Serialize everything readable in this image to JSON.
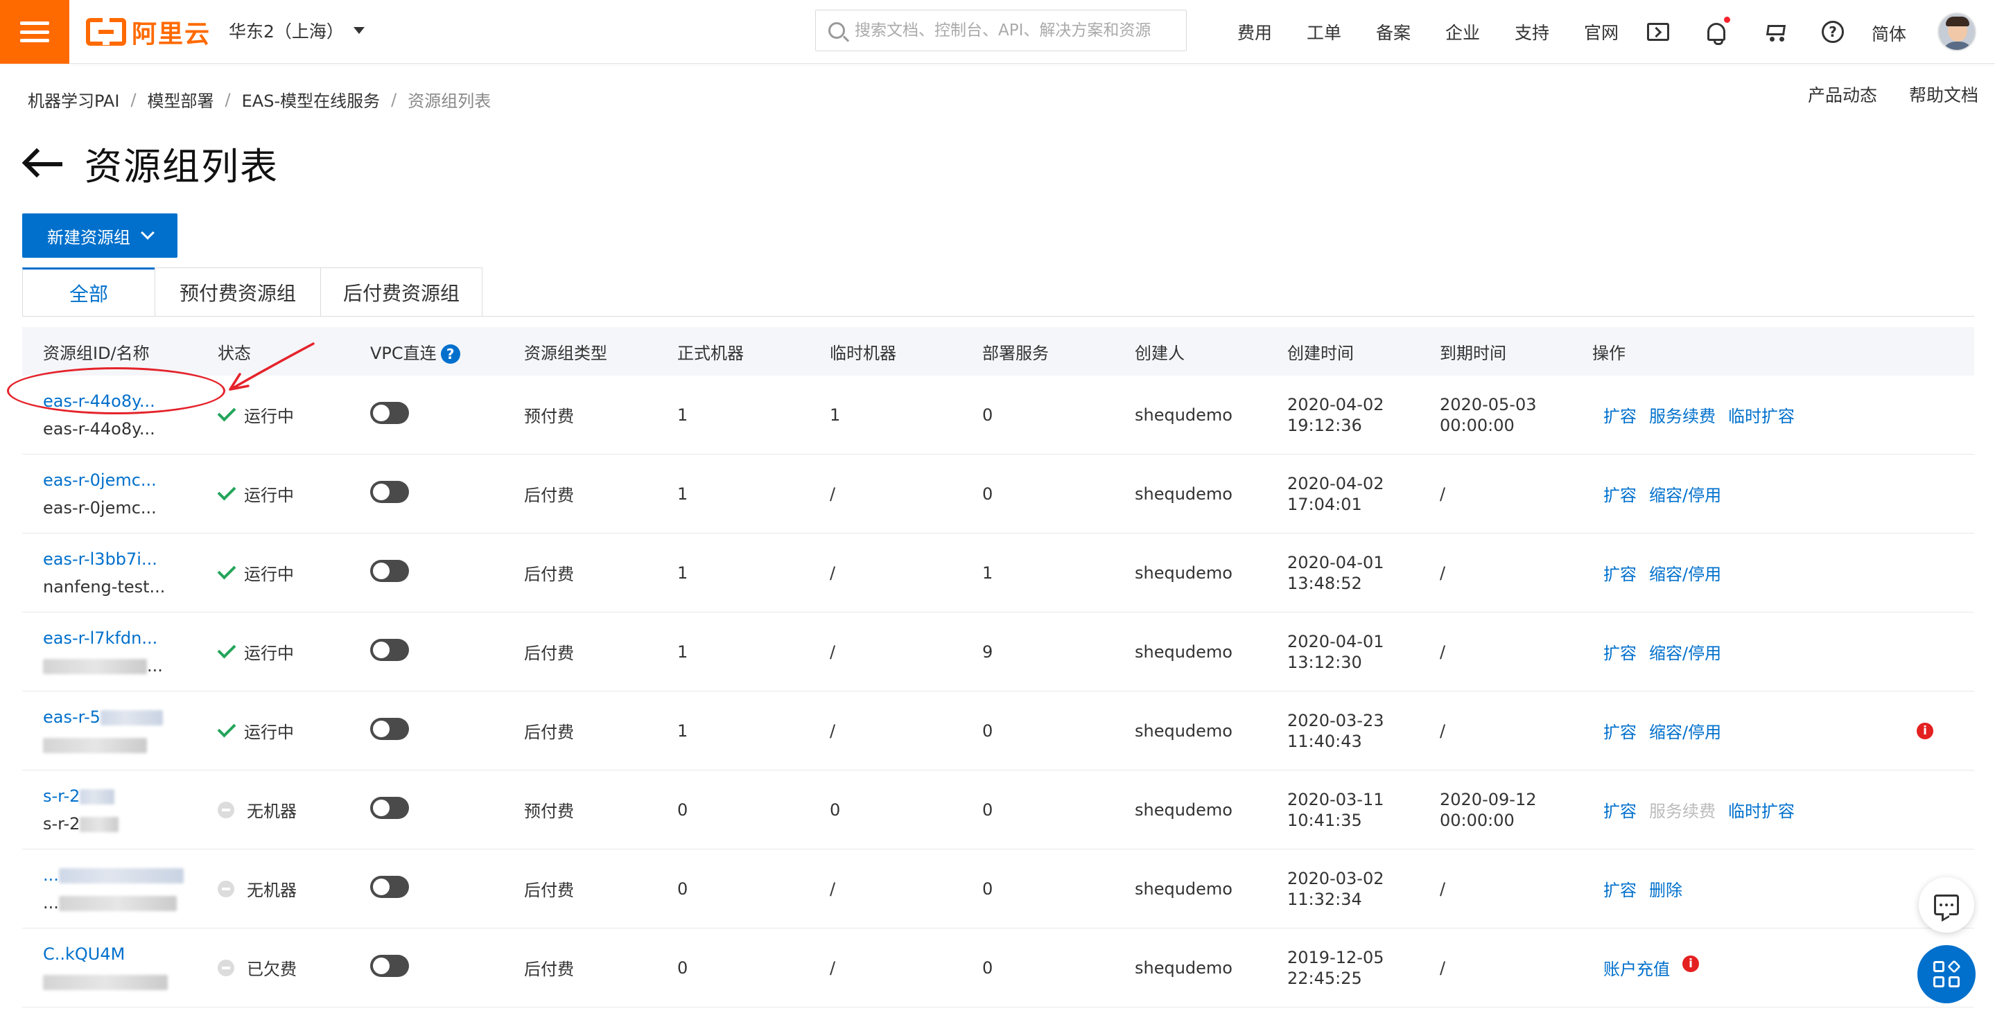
{
  "brand": {
    "logo_text": "阿里云",
    "accent": "#ff6a00",
    "primary": "#0070cc"
  },
  "header": {
    "region": "华东2（上海）",
    "search_placeholder": "搜索文档、控制台、API、解决方案和资源",
    "nav": [
      "费用",
      "工单",
      "备案",
      "企业",
      "支持",
      "官网"
    ],
    "icons": [
      "terminal-icon",
      "bell-icon",
      "cart-icon",
      "help-icon"
    ],
    "language": "简体"
  },
  "breadcrumb": [
    "机器学习PAI",
    "模型部署",
    "EAS-模型在线服务",
    "资源组列表"
  ],
  "top_links": {
    "news": "产品动态",
    "help_docs": "帮助文档"
  },
  "page": {
    "title": "资源组列表",
    "new_button": "新建资源组"
  },
  "tabs": [
    "全部",
    "预付费资源组",
    "后付费资源组"
  ],
  "table": {
    "headers": [
      "资源组ID/名称",
      "状态",
      "VPC直连",
      "资源组类型",
      "正式机器",
      "临时机器",
      "部署服务",
      "创建人",
      "创建时间",
      "到期时间",
      "操作"
    ],
    "vpc_help": "?",
    "rows": [
      {
        "id": "eas-r-44o8y...",
        "name": "eas-r-44o8y...",
        "status": "运行中",
        "status_kind": "ok",
        "type": "预付费",
        "formal": "1",
        "temp": "1",
        "services": "0",
        "creator": "shequdemo",
        "created_date": "2020-04-02",
        "created_time": "19:12:36",
        "expire_date": "2020-05-03",
        "expire_time": "00:00:00",
        "ops": [
          {
            "label": "扩容"
          },
          {
            "label": "服务续费"
          },
          {
            "label": "临时扩容"
          }
        ]
      },
      {
        "id": "eas-r-0jemc...",
        "name": "eas-r-0jemc...",
        "status": "运行中",
        "status_kind": "ok",
        "type": "后付费",
        "formal": "1",
        "temp": "/",
        "services": "0",
        "creator": "shequdemo",
        "created_date": "2020-04-02",
        "created_time": "17:04:01",
        "expire_date": "/",
        "expire_time": "",
        "ops": [
          {
            "label": "扩容"
          },
          {
            "label": "缩容/停用"
          }
        ]
      },
      {
        "id": "eas-r-l3bb7i...",
        "name": "nanfeng-test...",
        "status": "运行中",
        "status_kind": "ok",
        "type": "后付费",
        "formal": "1",
        "temp": "/",
        "services": "1",
        "creator": "shequdemo",
        "created_date": "2020-04-01",
        "created_time": "13:48:52",
        "expire_date": "/",
        "expire_time": "",
        "ops": [
          {
            "label": "扩容"
          },
          {
            "label": "缩容/停用"
          }
        ]
      },
      {
        "id": "eas-r-l7kfdn...",
        "name": "...",
        "status": "运行中",
        "status_kind": "ok",
        "type": "后付费",
        "formal": "1",
        "temp": "/",
        "services": "9",
        "creator": "shequdemo",
        "created_date": "2020-04-01",
        "created_time": "13:12:30",
        "expire_date": "/",
        "expire_time": "",
        "ops": [
          {
            "label": "扩容"
          },
          {
            "label": "缩容/停用"
          }
        ]
      },
      {
        "id": "eas-r-5",
        "name": "",
        "status": "运行中",
        "status_kind": "ok",
        "type": "后付费",
        "formal": "1",
        "temp": "/",
        "services": "0",
        "creator": "shequdemo",
        "created_date": "2020-03-23",
        "created_time": "11:40:43",
        "expire_date": "/",
        "expire_time": "",
        "ops": [
          {
            "label": "扩容"
          },
          {
            "label": "缩容/停用"
          }
        ],
        "alert": "i"
      },
      {
        "id": "s-r-2",
        "name": "s-r-2",
        "status": "无机器",
        "status_kind": "none",
        "type": "预付费",
        "formal": "0",
        "temp": "0",
        "services": "0",
        "creator": "shequdemo",
        "created_date": "2020-03-11",
        "created_time": "10:41:35",
        "expire_date": "2020-09-12",
        "expire_time": "00:00:00",
        "ops": [
          {
            "label": "扩容"
          },
          {
            "label": "服务续费",
            "disabled": true
          },
          {
            "label": "临时扩容"
          }
        ]
      },
      {
        "id": "...",
        "name": "...",
        "status": "无机器",
        "status_kind": "none",
        "type": "后付费",
        "formal": "0",
        "temp": "/",
        "services": "0",
        "creator": "shequdemo",
        "created_date": "2020-03-02",
        "created_time": "11:32:34",
        "expire_date": "/",
        "expire_time": "",
        "ops": [
          {
            "label": "扩容"
          },
          {
            "label": "删除"
          }
        ]
      },
      {
        "id": "C..kQU4M",
        "name": "",
        "status": "已欠费",
        "status_kind": "none",
        "type": "后付费",
        "formal": "0",
        "temp": "/",
        "services": "0",
        "creator": "shequdemo",
        "created_date": "2019-12-05",
        "created_time": "22:45:25",
        "expire_date": "/",
        "expire_time": "",
        "ops": [
          {
            "label": "账户充值",
            "info": "i"
          }
        ]
      }
    ]
  }
}
